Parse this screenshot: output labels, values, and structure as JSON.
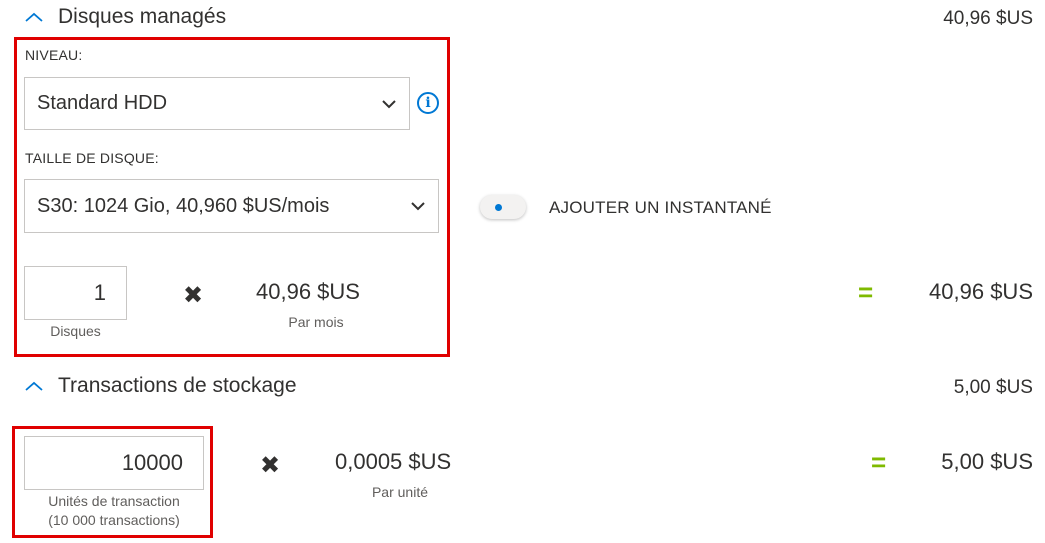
{
  "managed_disks": {
    "title": "Disques managés",
    "total": "40,96 $US",
    "tier_label": "NIVEAU:",
    "tier_value": "Standard HDD",
    "disk_size_label": "TAILLE DE DISQUE:",
    "disk_size_value": "S30: 1024 Gio, 40,960 $US/mois",
    "snapshot_label": "AJOUTER UN INSTANTANÉ",
    "snapshot_enabled": false,
    "quantity_value": "1",
    "quantity_label": "Disques",
    "unit_price": "40,96 $US",
    "unit_price_sub": "Par mois",
    "line_total": "40,96 $US"
  },
  "storage_transactions": {
    "title": "Transactions de stockage",
    "total": "5,00 $US",
    "quantity_value": "10000",
    "quantity_label_1": "Unités de transaction",
    "quantity_label_2": "(10 000 transactions)",
    "unit_price": "0,0005 $US",
    "unit_price_sub": "Par unité",
    "line_total": "5,00 $US"
  },
  "symbols": {
    "times": "✖",
    "equals": "="
  },
  "icons": {
    "collapse": "chevron-up-icon",
    "dropdown": "chevron-down-icon",
    "info": "info-icon"
  },
  "colors": {
    "highlight": "#e00000",
    "accent": "#0078d4",
    "equals": "#7fba00"
  }
}
